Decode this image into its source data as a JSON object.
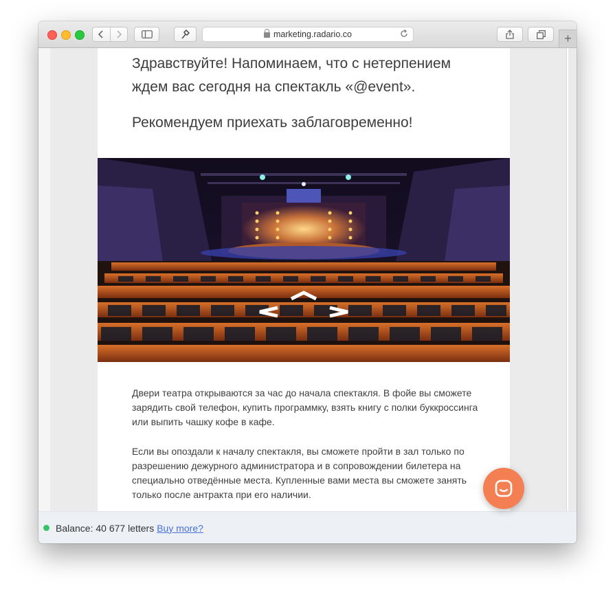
{
  "browser": {
    "address": "marketing.radario.co",
    "icons": [
      "back-icon",
      "forward-icon",
      "sidebar-icon",
      "extension-icon",
      "lock-icon",
      "reload-icon",
      "share-icon",
      "tabs-icon",
      "new-tab-icon"
    ]
  },
  "email": {
    "greeting": "Здравствуйте! Напоминаем, что с нетерпением ждем вас сегодня на спектакль «@event».",
    "recommendation": "Рекомендуем приехать заблаговременно!",
    "paragraph1": "Двери театра открываются за час до начала спектакля. В фойе вы сможете зарядить свой телефон, купить программку, взять книгу с полки буккроссинга или выпить чашку кофе в кафе.",
    "paragraph2": "Если вы опоздали к началу спектакля, вы сможете пройти в зал только по разрешению дежурного администратора и в сопровождении билетера на специально отведённые места. Купленные вами места вы сможете занять только после антракта при его наличии."
  },
  "footer": {
    "balance_text": "Balance: 40 677 letters",
    "buy_link": "Buy more?"
  },
  "colors": {
    "chat_button": "#f47f53",
    "status_dot": "#3ac46a",
    "link": "#4a6fd8"
  }
}
